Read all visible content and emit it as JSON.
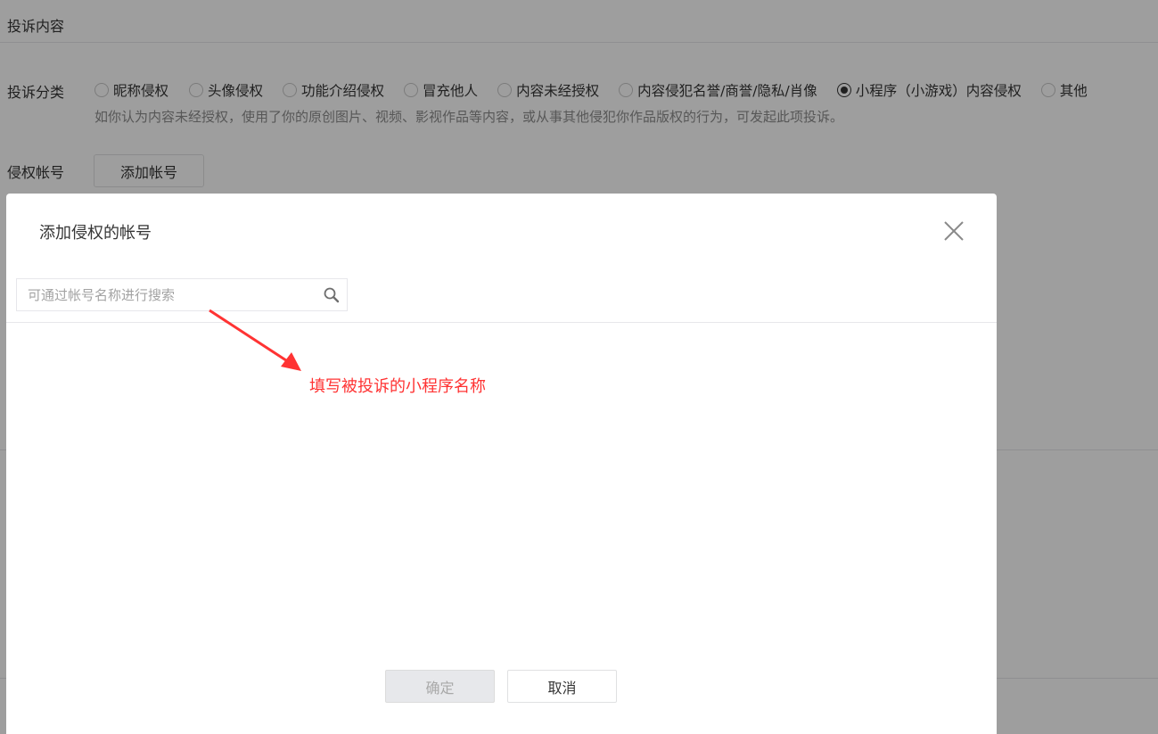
{
  "form": {
    "section_title": "投诉内容",
    "category_label": "投诉分类",
    "categories": [
      {
        "label": "昵称侵权",
        "checked": false
      },
      {
        "label": "头像侵权",
        "checked": false
      },
      {
        "label": "功能介绍侵权",
        "checked": false
      },
      {
        "label": "冒充他人",
        "checked": false
      },
      {
        "label": "内容未经授权",
        "checked": false
      },
      {
        "label": "内容侵犯名誉/商誉/隐私/肖像",
        "checked": false
      },
      {
        "label": "小程序（小游戏）内容侵权",
        "checked": true
      },
      {
        "label": "其他",
        "checked": false
      }
    ],
    "category_hint": "如你认为内容未经授权，使用了你的原创图片、视频、影视作品等内容，或从事其他侵犯你作品版权的行为，可发起此项投诉。",
    "account_label": "侵权帐号",
    "add_account_button": "添加帐号"
  },
  "dialog": {
    "title": "添加侵权的帐号",
    "search": {
      "placeholder": "可通过帐号名称进行搜索",
      "value": ""
    },
    "annotation": "填写被投诉的小程序名称",
    "confirm_label": "确定",
    "cancel_label": "取消",
    "confirm_disabled": true
  },
  "icons": {
    "close": "close-icon",
    "search": "search-icon"
  },
  "colors": {
    "annotation": "#ff3333",
    "text": "#353535",
    "hint": "#8d8d8d",
    "overlay": "rgba(0,0,0,0.38)"
  }
}
